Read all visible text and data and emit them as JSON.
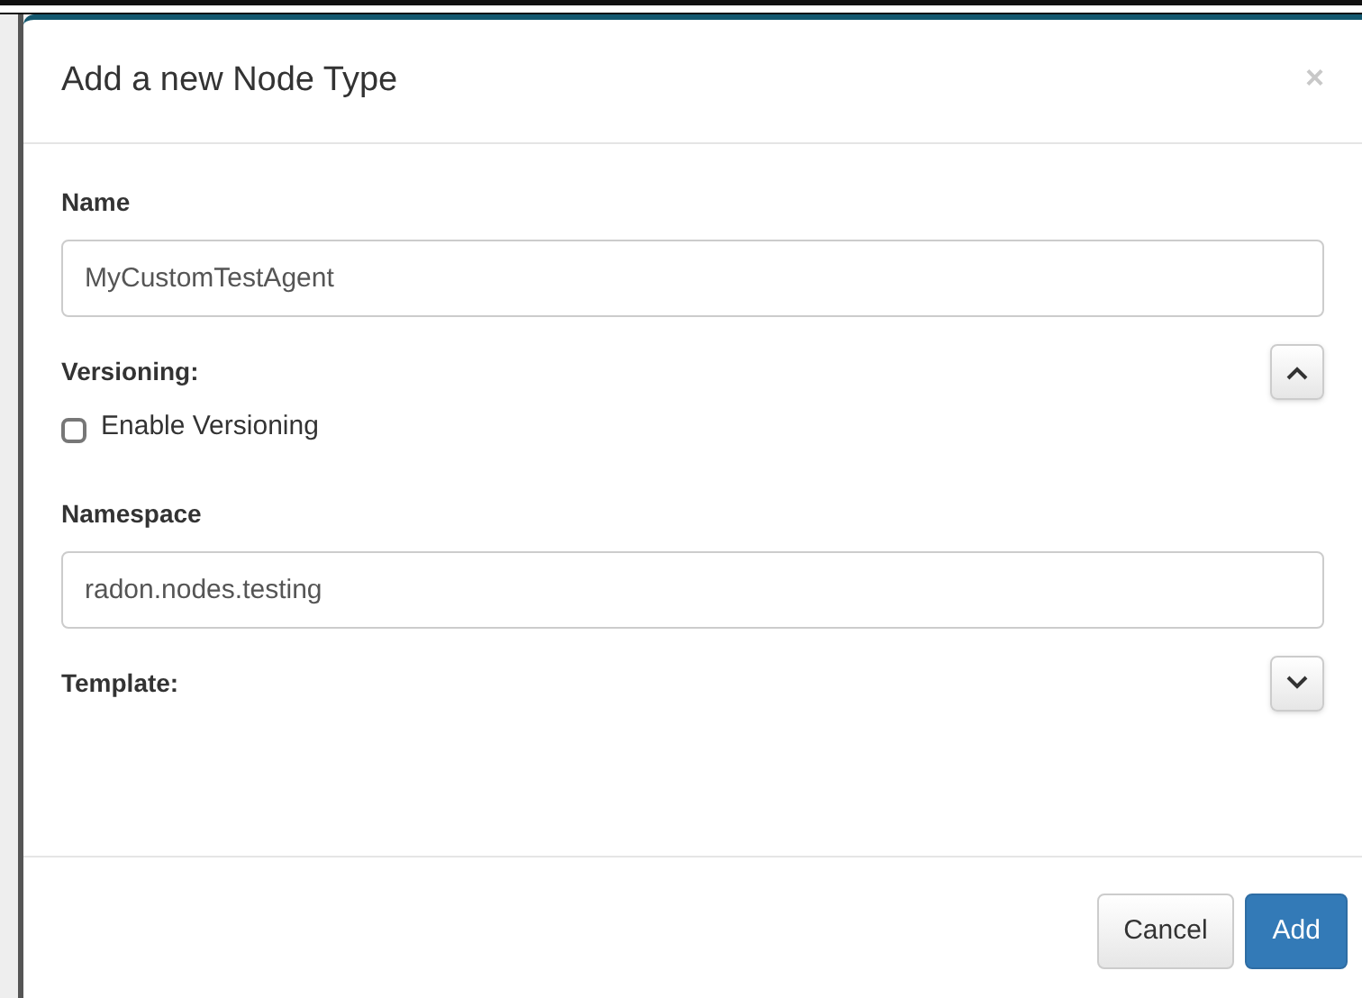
{
  "dialog": {
    "title": "Add a new Node Type",
    "close": "×",
    "fields": [
      {
        "kind": "input",
        "label": "Name",
        "value": "MyCustomTestAgent"
      },
      {
        "kind": "section",
        "label": "Versioning:",
        "expanded": true,
        "checkbox": {
          "label": "Enable Versioning",
          "checked": false
        }
      },
      {
        "kind": "input",
        "label": "Namespace",
        "value": "radon.nodes.testing"
      },
      {
        "kind": "section",
        "label": "Template:",
        "expanded": false
      }
    ],
    "buttons": [
      {
        "label": "Cancel",
        "kind": "default"
      },
      {
        "label": "Add",
        "kind": "primary"
      }
    ]
  }
}
